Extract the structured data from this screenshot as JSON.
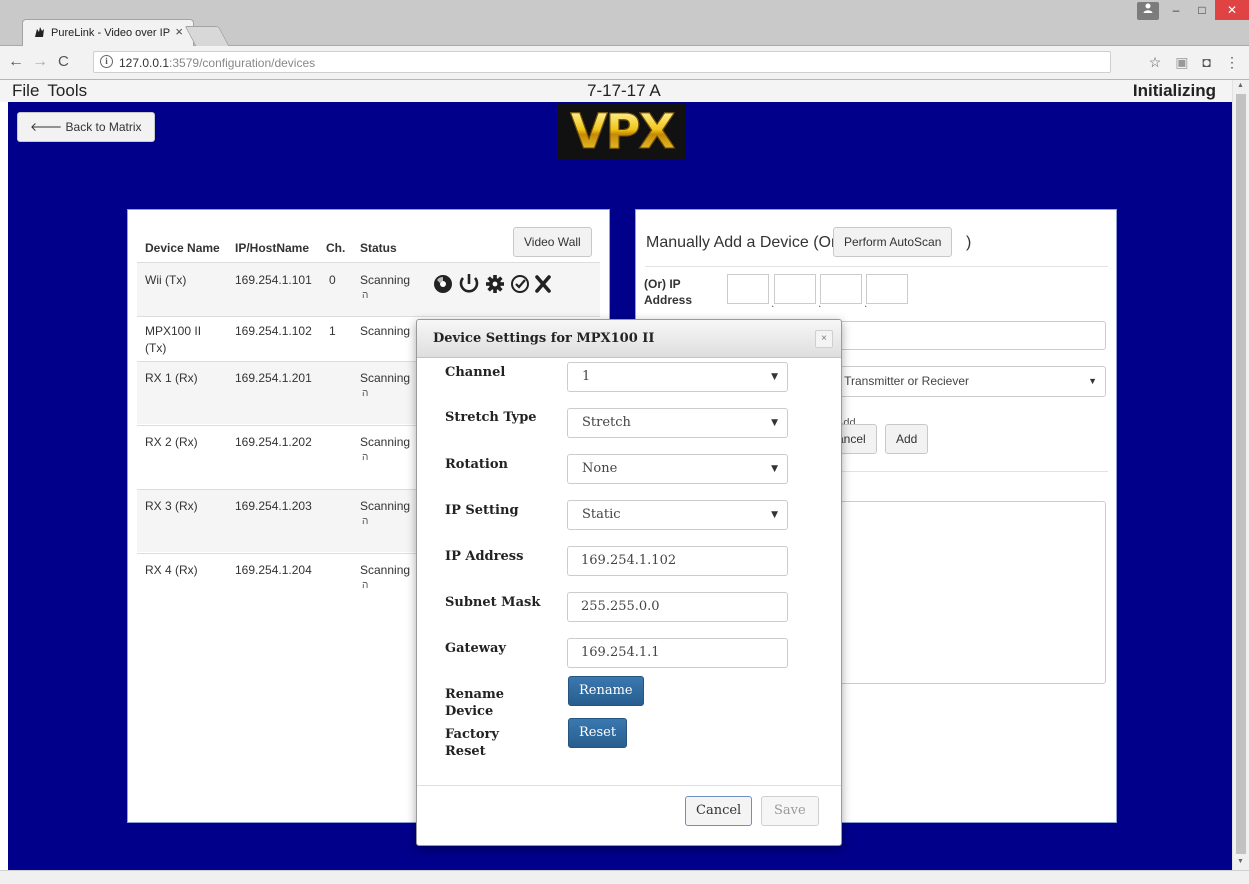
{
  "browser": {
    "tab_title": "PureLink - Video over IP",
    "tab_close": "×",
    "url_host": "127.0.0.1",
    "url_rest": ":3579/configuration/devices",
    "info_glyph": "i"
  },
  "app": {
    "menu": [
      "File",
      "Tools"
    ],
    "title": "7-17-17 A",
    "status": "Initializing"
  },
  "main": {
    "back_label": "Back to Matrix",
    "logo_text": "VPX"
  },
  "devices": {
    "video_wall_label": "Video Wall",
    "columns": [
      "Device Name",
      "IP/HostName",
      "Ch.",
      "Status"
    ],
    "rows": [
      {
        "name": "Wii (Tx)",
        "ip": "169.254.1.101",
        "ch": "0",
        "status": "Scanning"
      },
      {
        "name": "MPX100 II (Tx)",
        "ip": "169.254.1.102",
        "ch": "1",
        "status": "Scanning"
      },
      {
        "name": "RX 1 (Rx)",
        "ip": "169.254.1.201",
        "ch": "",
        "status": "Scanning"
      },
      {
        "name": "RX 2 (Rx)",
        "ip": "169.254.1.202",
        "ch": "",
        "status": "Scanning"
      },
      {
        "name": "RX 3 (Rx)",
        "ip": "169.254.1.203",
        "ch": "",
        "status": "Scanning"
      },
      {
        "name": "RX 4 (Rx)",
        "ip": "169.254.1.204",
        "ch": "",
        "status": "Scanning"
      }
    ],
    "wifi_glyph": "ה",
    "row_icons": [
      "disc-icon",
      "power-icon",
      "gear-icon",
      "check-circle-icon",
      "delete-x-icon"
    ]
  },
  "add_device": {
    "title": "Manually Add a Device (Or",
    "autoscan_label": "Perform AutoScan",
    "close_paren": ")",
    "ip_label": "(Or) IP Address",
    "type_select_value": "r Transmitter or Reciever",
    "add_hint": "Add",
    "cancel_label": "ancel",
    "add_label": "Add"
  },
  "modal": {
    "title": "Device Settings for MPX100 II",
    "close_label": "×",
    "channel_label": "Channel",
    "channel_value": "1",
    "stretch_label": "Stretch Type",
    "stretch_value": "Stretch",
    "rotation_label": "Rotation",
    "rotation_value": "None",
    "ip_setting_label": "IP Setting",
    "ip_setting_value": "Static",
    "ip_address_label": "IP Address",
    "ip_address_value": "169.254.1.102",
    "subnet_label": "Subnet Mask",
    "subnet_value": "255.255.0.0",
    "gateway_label": "Gateway",
    "gateway_value": "169.254.1.1",
    "rename_label": "Rename Device",
    "rename_button": "Rename",
    "factory_label": "Factory Reset",
    "reset_button": "Reset",
    "cancel_button": "Cancel",
    "save_button": "Save"
  },
  "colors": {
    "background": "#00008b",
    "primary_button": "#2f6da3",
    "logo_gold": "#e8b40a"
  }
}
